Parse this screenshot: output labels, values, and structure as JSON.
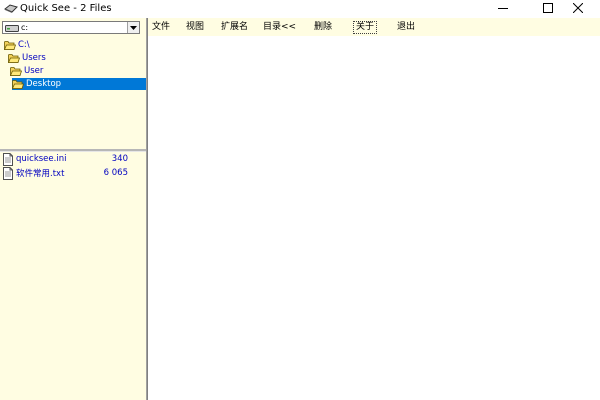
{
  "window": {
    "title": "Quick See - 2 Files",
    "controls": {
      "minimize": "minimize-icon",
      "maximize": "maximize-icon",
      "close": "close-icon"
    }
  },
  "drive_selector": {
    "value": "c:",
    "icon": "drive-icon"
  },
  "tree": {
    "items": [
      {
        "label": "C:\\",
        "selected": false
      },
      {
        "label": "Users",
        "selected": false
      },
      {
        "label": "User",
        "selected": false
      },
      {
        "label": "Desktop",
        "selected": true
      }
    ]
  },
  "files": [
    {
      "name": "quicksee.ini",
      "size": "340"
    },
    {
      "name": "软件常用.txt",
      "size": "6 065"
    }
  ],
  "menu": {
    "file": "文件",
    "view": "视图",
    "extension": "扩展名",
    "directory": "目录<<",
    "delete": "删除",
    "about": "关于",
    "exit": "退出"
  },
  "colors": {
    "panel_background": "#fffde2",
    "selection": "#0078d7",
    "link_text": "#0000c0"
  }
}
